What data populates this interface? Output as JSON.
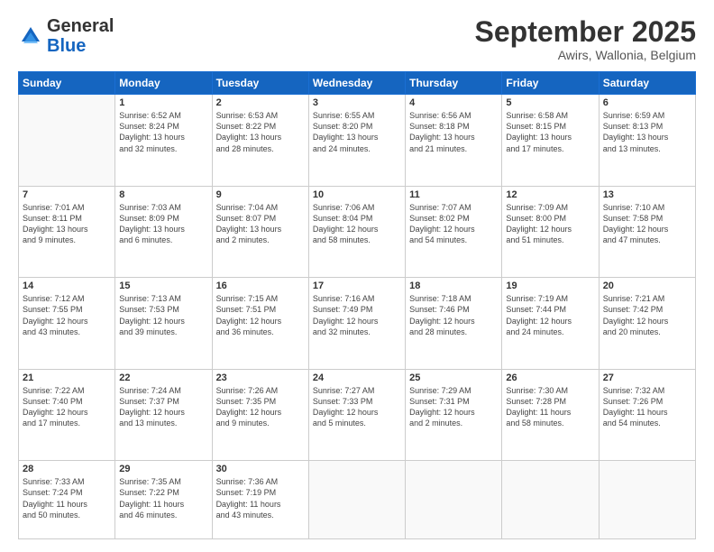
{
  "header": {
    "logo_general": "General",
    "logo_blue": "Blue",
    "title": "September 2025",
    "location": "Awirs, Wallonia, Belgium"
  },
  "days_of_week": [
    "Sunday",
    "Monday",
    "Tuesday",
    "Wednesday",
    "Thursday",
    "Friday",
    "Saturday"
  ],
  "weeks": [
    [
      {
        "day": "",
        "info": ""
      },
      {
        "day": "1",
        "info": "Sunrise: 6:52 AM\nSunset: 8:24 PM\nDaylight: 13 hours\nand 32 minutes."
      },
      {
        "day": "2",
        "info": "Sunrise: 6:53 AM\nSunset: 8:22 PM\nDaylight: 13 hours\nand 28 minutes."
      },
      {
        "day": "3",
        "info": "Sunrise: 6:55 AM\nSunset: 8:20 PM\nDaylight: 13 hours\nand 24 minutes."
      },
      {
        "day": "4",
        "info": "Sunrise: 6:56 AM\nSunset: 8:18 PM\nDaylight: 13 hours\nand 21 minutes."
      },
      {
        "day": "5",
        "info": "Sunrise: 6:58 AM\nSunset: 8:15 PM\nDaylight: 13 hours\nand 17 minutes."
      },
      {
        "day": "6",
        "info": "Sunrise: 6:59 AM\nSunset: 8:13 PM\nDaylight: 13 hours\nand 13 minutes."
      }
    ],
    [
      {
        "day": "7",
        "info": "Sunrise: 7:01 AM\nSunset: 8:11 PM\nDaylight: 13 hours\nand 9 minutes."
      },
      {
        "day": "8",
        "info": "Sunrise: 7:03 AM\nSunset: 8:09 PM\nDaylight: 13 hours\nand 6 minutes."
      },
      {
        "day": "9",
        "info": "Sunrise: 7:04 AM\nSunset: 8:07 PM\nDaylight: 13 hours\nand 2 minutes."
      },
      {
        "day": "10",
        "info": "Sunrise: 7:06 AM\nSunset: 8:04 PM\nDaylight: 12 hours\nand 58 minutes."
      },
      {
        "day": "11",
        "info": "Sunrise: 7:07 AM\nSunset: 8:02 PM\nDaylight: 12 hours\nand 54 minutes."
      },
      {
        "day": "12",
        "info": "Sunrise: 7:09 AM\nSunset: 8:00 PM\nDaylight: 12 hours\nand 51 minutes."
      },
      {
        "day": "13",
        "info": "Sunrise: 7:10 AM\nSunset: 7:58 PM\nDaylight: 12 hours\nand 47 minutes."
      }
    ],
    [
      {
        "day": "14",
        "info": "Sunrise: 7:12 AM\nSunset: 7:55 PM\nDaylight: 12 hours\nand 43 minutes."
      },
      {
        "day": "15",
        "info": "Sunrise: 7:13 AM\nSunset: 7:53 PM\nDaylight: 12 hours\nand 39 minutes."
      },
      {
        "day": "16",
        "info": "Sunrise: 7:15 AM\nSunset: 7:51 PM\nDaylight: 12 hours\nand 36 minutes."
      },
      {
        "day": "17",
        "info": "Sunrise: 7:16 AM\nSunset: 7:49 PM\nDaylight: 12 hours\nand 32 minutes."
      },
      {
        "day": "18",
        "info": "Sunrise: 7:18 AM\nSunset: 7:46 PM\nDaylight: 12 hours\nand 28 minutes."
      },
      {
        "day": "19",
        "info": "Sunrise: 7:19 AM\nSunset: 7:44 PM\nDaylight: 12 hours\nand 24 minutes."
      },
      {
        "day": "20",
        "info": "Sunrise: 7:21 AM\nSunset: 7:42 PM\nDaylight: 12 hours\nand 20 minutes."
      }
    ],
    [
      {
        "day": "21",
        "info": "Sunrise: 7:22 AM\nSunset: 7:40 PM\nDaylight: 12 hours\nand 17 minutes."
      },
      {
        "day": "22",
        "info": "Sunrise: 7:24 AM\nSunset: 7:37 PM\nDaylight: 12 hours\nand 13 minutes."
      },
      {
        "day": "23",
        "info": "Sunrise: 7:26 AM\nSunset: 7:35 PM\nDaylight: 12 hours\nand 9 minutes."
      },
      {
        "day": "24",
        "info": "Sunrise: 7:27 AM\nSunset: 7:33 PM\nDaylight: 12 hours\nand 5 minutes."
      },
      {
        "day": "25",
        "info": "Sunrise: 7:29 AM\nSunset: 7:31 PM\nDaylight: 12 hours\nand 2 minutes."
      },
      {
        "day": "26",
        "info": "Sunrise: 7:30 AM\nSunset: 7:28 PM\nDaylight: 11 hours\nand 58 minutes."
      },
      {
        "day": "27",
        "info": "Sunrise: 7:32 AM\nSunset: 7:26 PM\nDaylight: 11 hours\nand 54 minutes."
      }
    ],
    [
      {
        "day": "28",
        "info": "Sunrise: 7:33 AM\nSunset: 7:24 PM\nDaylight: 11 hours\nand 50 minutes."
      },
      {
        "day": "29",
        "info": "Sunrise: 7:35 AM\nSunset: 7:22 PM\nDaylight: 11 hours\nand 46 minutes."
      },
      {
        "day": "30",
        "info": "Sunrise: 7:36 AM\nSunset: 7:19 PM\nDaylight: 11 hours\nand 43 minutes."
      },
      {
        "day": "",
        "info": ""
      },
      {
        "day": "",
        "info": ""
      },
      {
        "day": "",
        "info": ""
      },
      {
        "day": "",
        "info": ""
      }
    ]
  ]
}
